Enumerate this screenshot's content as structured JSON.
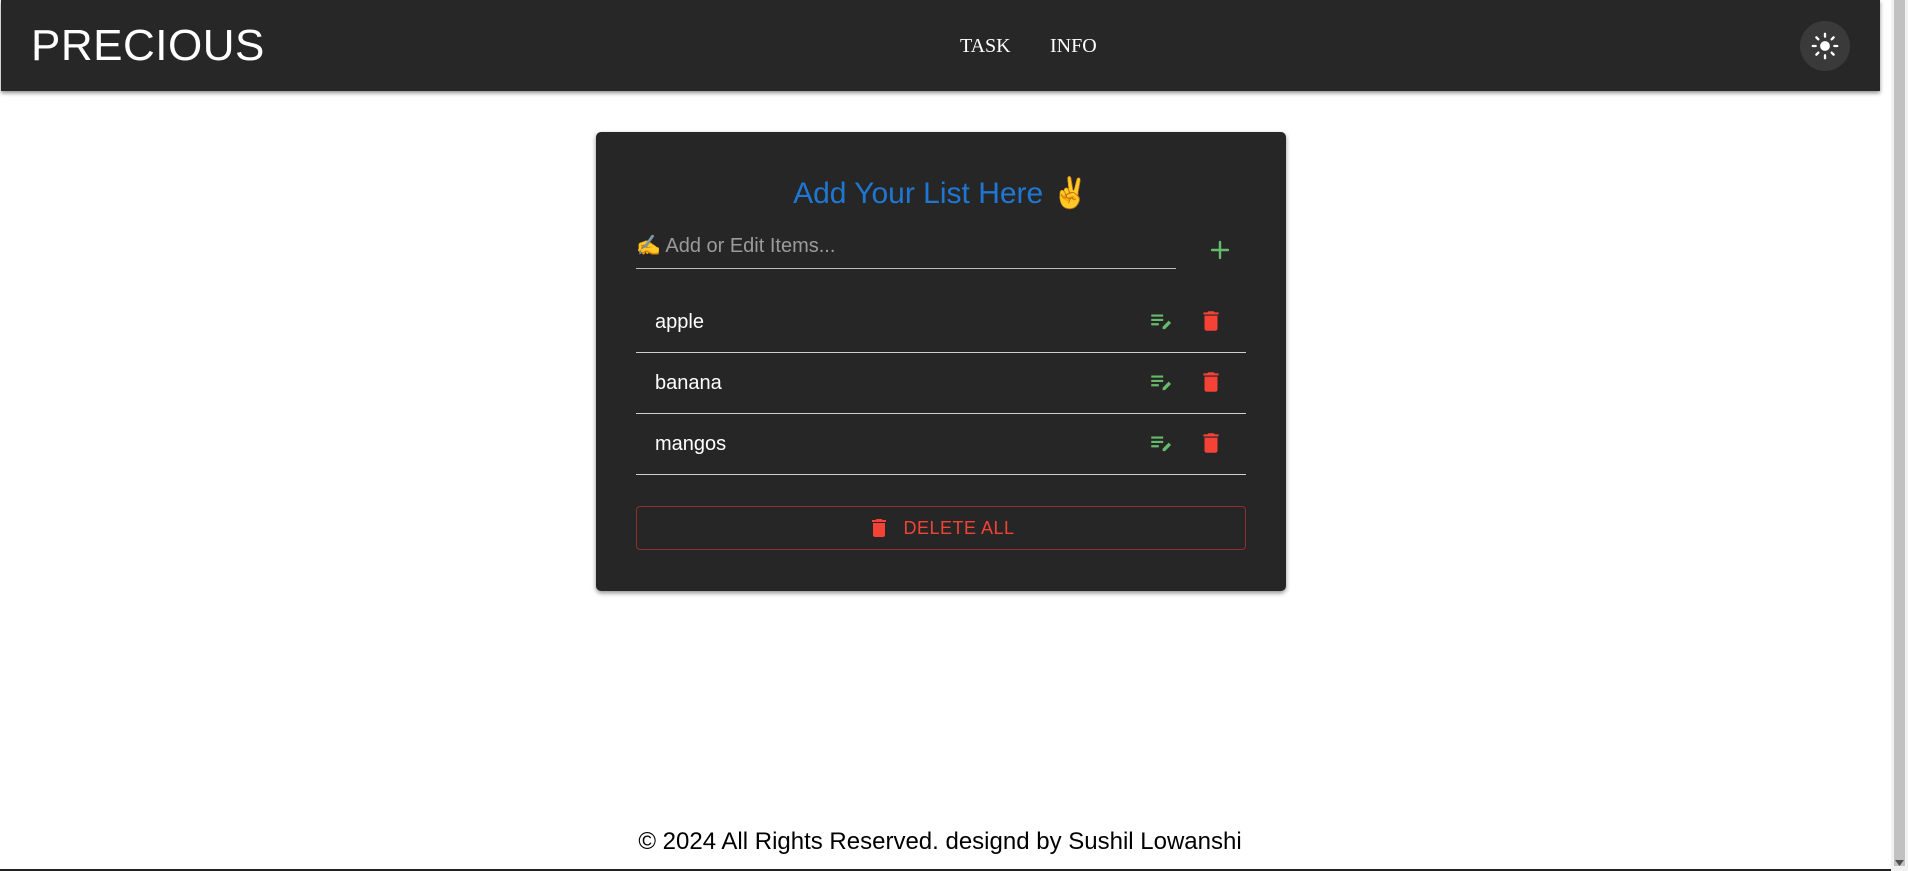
{
  "header": {
    "brand": "PRECIOUS",
    "nav": [
      {
        "label": "TASK"
      },
      {
        "label": "INFO"
      }
    ],
    "theme_toggle_icon": "sun-icon"
  },
  "card": {
    "title": "Add Your List Here ✌️",
    "input": {
      "placeholder": "✍️ Add or Edit Items...",
      "value": ""
    },
    "add_icon": "plus-icon",
    "items": [
      {
        "label": "apple"
      },
      {
        "label": "banana"
      },
      {
        "label": "mangos"
      }
    ],
    "item_action_icons": [
      "edit-list-icon",
      "trash-icon"
    ],
    "delete_all_label": "DELETE ALL"
  },
  "footer": {
    "text": "© 2024 All Rights Reserved. designd by Sushil Lowanshi"
  },
  "colors": {
    "appbar_bg": "#272727",
    "card_bg": "#262626",
    "title_blue": "#1f76d3",
    "edit_green": "#66bb6a",
    "delete_red": "#f44336"
  }
}
